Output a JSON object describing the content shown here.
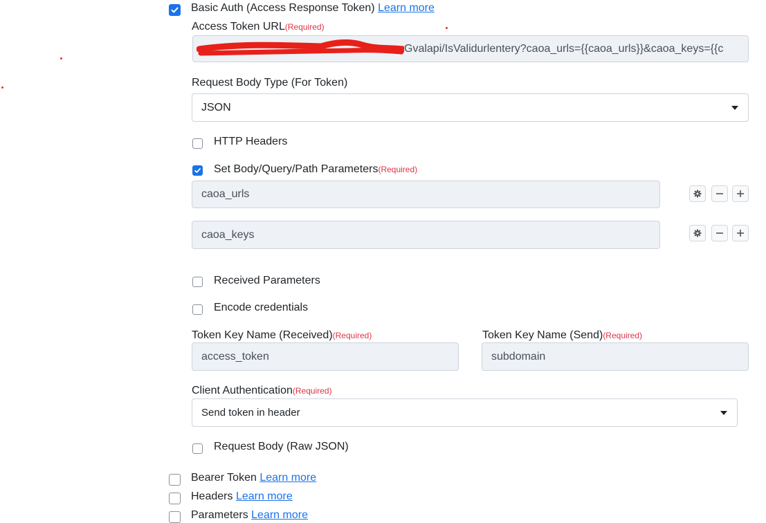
{
  "basic_auth": {
    "label": "Basic Auth (Access Response Token)",
    "learn_more": "Learn more",
    "checked": true
  },
  "access_token_url": {
    "label": "Access Token URL",
    "required": "(Required)",
    "value": "Gvalapi/IsValidurlentery?caoa_urls={{caoa_urls}}&caoa_keys={{c"
  },
  "request_body_type": {
    "label": "Request Body Type (For Token)",
    "value": "JSON"
  },
  "http_headers": {
    "label": "HTTP Headers",
    "checked": false
  },
  "set_body_params": {
    "label": "Set Body/Query/Path Parameters",
    "required": "(Required)",
    "checked": true,
    "params": [
      {
        "value": "caoa_urls"
      },
      {
        "value": "caoa_keys"
      }
    ]
  },
  "received_params": {
    "label": "Received Parameters",
    "checked": false
  },
  "encode_credentials": {
    "label": "Encode credentials",
    "checked": false
  },
  "token_key_received": {
    "label": "Token Key Name (Received)",
    "required": "(Required)",
    "value": "access_token"
  },
  "token_key_send": {
    "label": "Token Key Name (Send)",
    "required": "(Required)",
    "value": "subdomain"
  },
  "client_auth": {
    "label": "Client Authentication",
    "required": "(Required)",
    "value": "Send token in header"
  },
  "request_body_raw": {
    "label": "Request Body (Raw JSON)",
    "checked": false
  },
  "bearer_token": {
    "label": "Bearer Token",
    "learn_more": "Learn more",
    "checked": false
  },
  "headers": {
    "label": "Headers",
    "learn_more": "Learn more",
    "checked": false
  },
  "parameters": {
    "label": "Parameters",
    "learn_more": "Learn more",
    "checked": false
  },
  "colors": {
    "accent": "#1a73e8",
    "required": "#dc3545",
    "redaction": "#e8201a"
  }
}
